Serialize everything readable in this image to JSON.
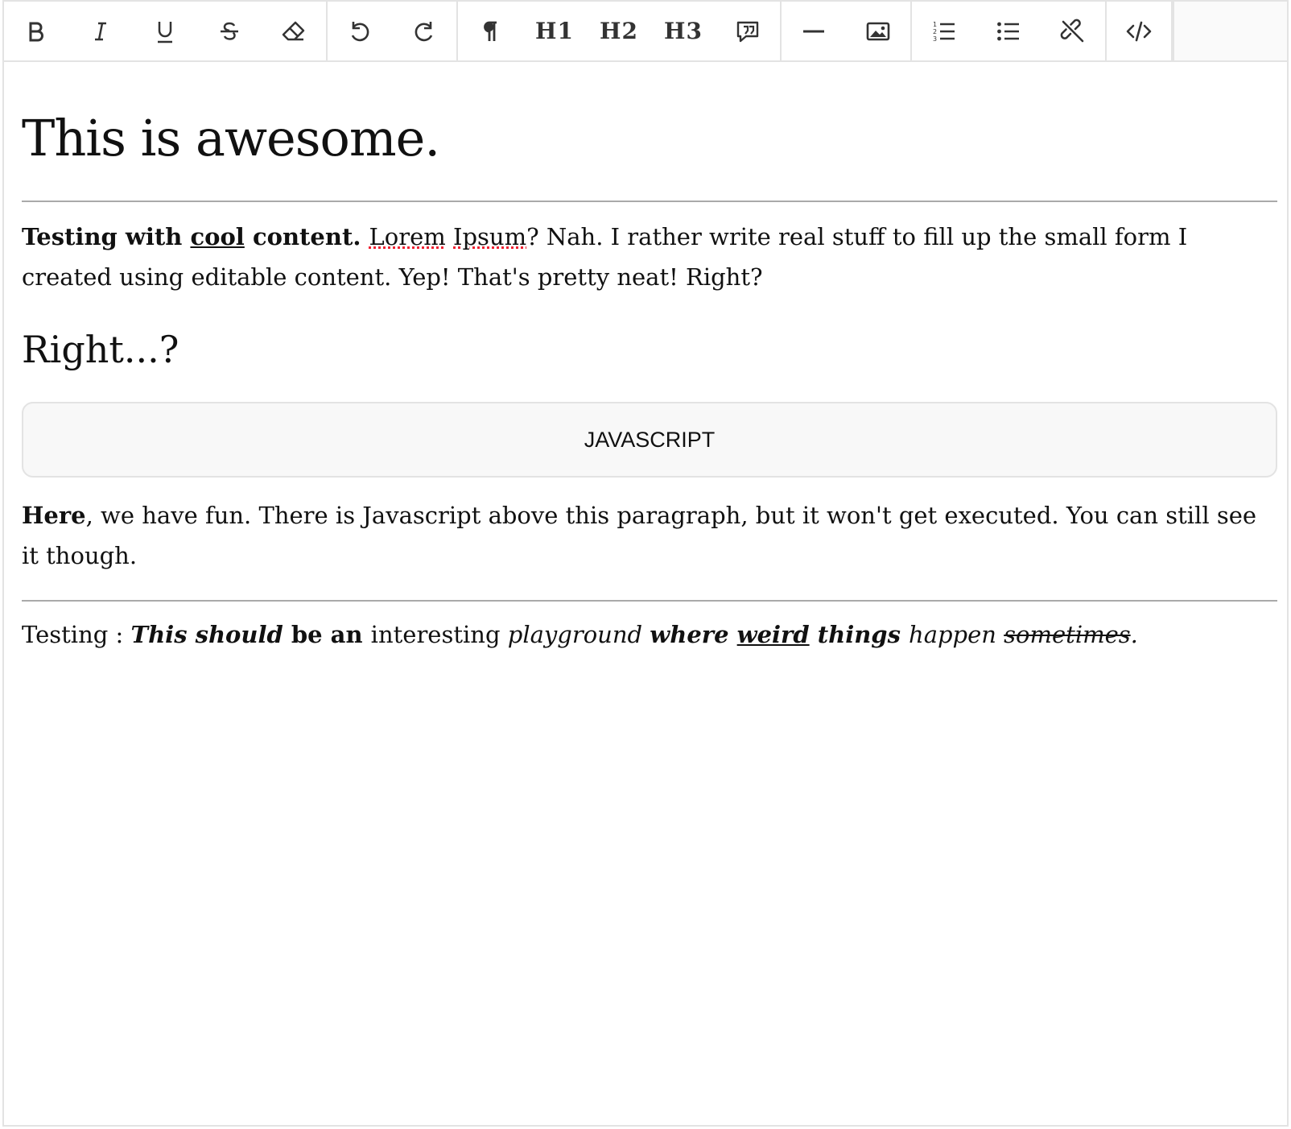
{
  "toolbar": {
    "h1_label": "H1",
    "h2_label": "H2",
    "h3_label": "H3"
  },
  "doc": {
    "title": "This is awesome.",
    "p1": {
      "bold_a": "Testing with ",
      "cool": "cool",
      "bold_b": " content. ",
      "lorem": "Lorem",
      "space": " ",
      "ipsum": "Ipsum",
      "rest": "? Nah. I rather write real stuff to fill up the small form I created using editable content. Yep! That's pretty neat! Right?"
    },
    "subheading": "Right...?",
    "code_label": "JAVASCRIPT",
    "p2": {
      "here": "Here",
      "rest": ", we have fun. There is Javascript above this paragraph, but it won't get executed. You can still see it though."
    },
    "p3": {
      "a": "Testing : ",
      "b": "This should",
      "c": " be an ",
      "d": "interesting ",
      "e": "playground ",
      "f": "where ",
      "g": "weird",
      "h": " things ",
      "i": "happen ",
      "j": "sometimes",
      "k": "."
    }
  }
}
